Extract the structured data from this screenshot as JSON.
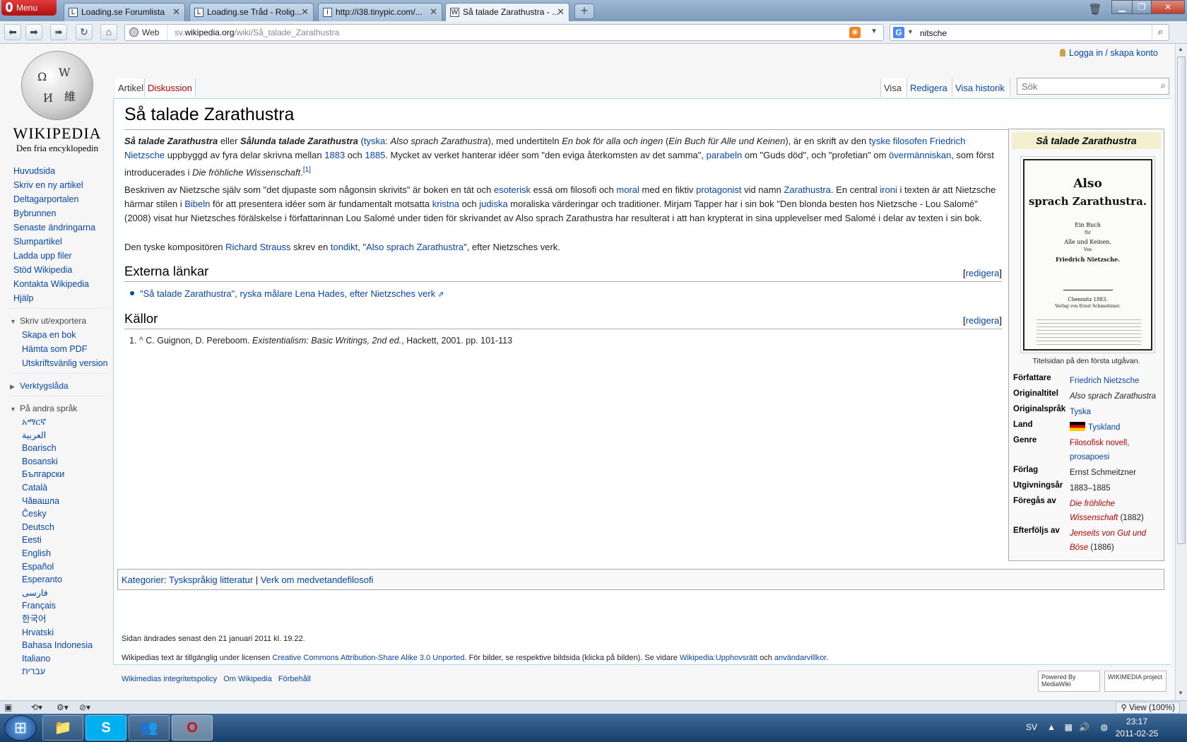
{
  "browser": {
    "menu_label": "Menu",
    "tabs": [
      {
        "title": "Loading.se Forumlista",
        "icon": "L"
      },
      {
        "title": "Loading.se Tråd - Rolig...",
        "icon": "L"
      },
      {
        "title": "http://i38.tinypic.com/...",
        "icon": "i"
      },
      {
        "title": "Så talade Zarathustra - ...",
        "icon": "W"
      }
    ],
    "address_mode": "Web",
    "url_prefix": "sv.",
    "url_domain": "wikipedia.org",
    "url_path": "/wiki/Så_talade_Zarathustra",
    "search_query": "nitsche",
    "search_engine_icon": "G",
    "zoom": "View (100%)"
  },
  "wiki": {
    "logo_wordmark": "WIKIPEDIA",
    "logo_tagline": "Den fria encyklopedin",
    "personal_link": "Logga in / skapa konto",
    "tabs_left": [
      "Artikel",
      "Diskussion"
    ],
    "tabs_right": [
      "Visa",
      "Redigera",
      "Visa historik"
    ],
    "search_placeholder": "Sök",
    "nav": [
      "Huvudsida",
      "Skriv en ny artikel",
      "Deltagarportalen",
      "Bybrunnen",
      "Senaste ändringarna",
      "Slumpartikel",
      "Ladda upp filer",
      "Stöd Wikipedia",
      "Kontakta Wikipedia",
      "Hjälp"
    ],
    "print_heading": "Skriv ut/exportera",
    "print_items": [
      "Skapa en bok",
      "Hämta som PDF",
      "Utskriftsvänlig version"
    ],
    "toolbox_heading": "Verktygslåda",
    "lang_heading": "På andra språk",
    "languages": [
      "አማርኛ",
      "العربية",
      "Boarisch",
      "Bosanski",
      "Български",
      "Català",
      "Чăвашла",
      "Česky",
      "Deutsch",
      "Eesti",
      "English",
      "Español",
      "Esperanto",
      "فارسی",
      "Français",
      "한국어",
      "Hrvatski",
      "Bahasa Indonesia",
      "Italiano",
      "עברית"
    ]
  },
  "article": {
    "title": "Så talade Zarathustra",
    "p1": {
      "a": "Så talade Zarathustra",
      "b": " eller ",
      "c": "Sålunda talade Zarathustra",
      "d": " (",
      "e": "tyska",
      "f": ": ",
      "g": "Also sprach Zarathustra",
      "h": "), med undertiteln ",
      "i": "En bok för alla och ingen",
      "j": " (",
      "k": "Ein Buch für Alle und Keinen",
      "l": "), är en skrift av den ",
      "m": "tyske filosofen",
      "n": " ",
      "o": "Friedrich Nietzsche",
      "p": " uppbyggd av fyra delar skrivna mellan ",
      "q": "1883",
      "r": " och ",
      "s": "1885",
      "t": ". Mycket av verket hanterar idéer som \"den eviga återkomsten av det samma\", ",
      "u": "parabeln",
      "v": " om \"Guds död\", och \"profetian\" om ",
      "w": "övermänniskan",
      "x": ", som först introducerades i ",
      "y": "Die fröhliche Wissenschaft",
      "z": ".",
      "ref": "[1]"
    },
    "p2": {
      "a": "Beskriven av Nietzsche själv som \"det djupaste som någonsin skrivits\" är boken en tät och ",
      "b": "esoterisk",
      "c": " essä om filosofi och ",
      "d": "moral",
      "e": " med en fiktiv ",
      "f": "protagonist",
      "g": " vid namn ",
      "h": "Zarathustra",
      "i": ". En central ",
      "j": "ironi",
      "k": " i texten är att Nietzsche härmar stilen i ",
      "l": "Bibeln",
      "m": " för att presentera idéer som är fundamentalt motsatta ",
      "n": "kristna",
      "o": " och ",
      "p": "judiska",
      "q": " moraliska värderingar och traditioner. Mirjam Tapper har i sin bok \"Den blonda besten hos Nietzsche - Lou Salomé\" (2008) visat hur Nietzsches förälskelse i författarinnan Lou Salomé under tiden för skrivandet av Also sprach Zarathustra har resulterat i att han krypterat in sina upplevelser med Salomé i delar av texten i sin bok."
    },
    "p3": {
      "a": "Den tyske kompositören ",
      "b": "Richard Strauss",
      "c": " skrev en ",
      "d": "tondikt",
      "e": ", \"",
      "f": "Also sprach Zarathustra",
      "g": "\", efter Nietzsches verk."
    },
    "h_external": "Externa länkar",
    "edit_label": "redigera",
    "external_link": "\"Så talade Zarathustra\", ryska målare Lena Hades, efter Nietzsches verk",
    "h_sources": "Källor",
    "ref1": {
      "num": "1.",
      "caret": "^",
      "a": " C. Guignon, D. Pereboom. ",
      "b": "Existentialism: Basic Writings, 2nd ed.",
      "c": ", Hackett, 2001. pp. 101-113"
    },
    "categories_label": "Kategorier",
    "categories": [
      "Tyskspråkig litteratur",
      "Verk om medvetandefilosofi"
    ]
  },
  "infobox": {
    "title": "Så talade Zarathustra",
    "cover": {
      "line1": "Also",
      "line2": "sprach Zarathustra.",
      "line3": "Ein Buch",
      "line4": "für",
      "line5": "Alle und Keinen.",
      "line6": "Von",
      "line7": "Friedrich Nietzsche.",
      "line8": "Chemnitz 1883.",
      "line9": "Verlag von Ernst Schmeitzner."
    },
    "caption": "Titelsidan på den första utgåvan.",
    "rows": {
      "author_k": "Författare",
      "author_v": "Friedrich Nietzsche",
      "orig_k": "Originaltitel",
      "orig_v": "Also sprach Zarathustra",
      "lang_k": "Originalspråk",
      "lang_v": "Tyska",
      "land_k": "Land",
      "land_v": "Tyskland",
      "genre_k": "Genre",
      "genre_v1": "Filosofisk novell",
      "genre_v2": "prosapoesi",
      "forlag_k": "Förlag",
      "forlag_v": "Ernst Schmeitzner",
      "year_k": "Utgivningsår",
      "year_v": "1883–1885",
      "prev_k": "Föregås av",
      "prev_v": "Die fröhliche Wissenschaft",
      "prev_y": " (1882)",
      "next_k": "Efterföljs av",
      "next_v": "Jenseits von Gut und Böse",
      "next_y": " (1886)"
    }
  },
  "footer": {
    "modified": "Sidan ändrades senast den 21 januari 2011 kl. 19.22.",
    "license_a": "Wikipedias text är tillgänglig under licensen ",
    "license_link": "Creative Commons Attribution-Share Alike 3.0 Unported",
    "license_b": ". För bilder, se respektive bildsida (klicka på bilden). Se vidare ",
    "license_link2": "Wikipedia:Upphovsrätt",
    "license_c": " och ",
    "license_link3": "användarvillkor",
    "license_d": ".",
    "links": [
      "Wikimedias integritetspolicy",
      "Om Wikipedia",
      "Förbehåll"
    ],
    "badge1": "Powered By MediaWiki",
    "badge2": "WIKIMEDIA project"
  },
  "taskbar": {
    "lang": "SV",
    "time": "23:17",
    "date": "2011-02-25"
  }
}
